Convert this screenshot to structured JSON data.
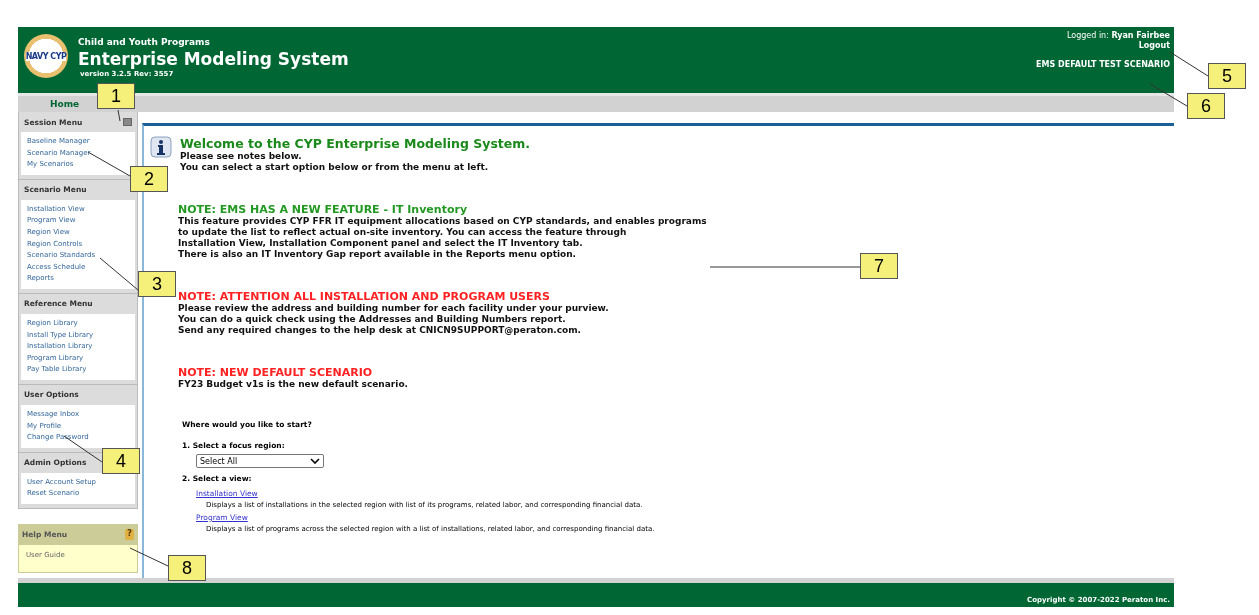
{
  "header": {
    "org": "Child and Youth Programs",
    "title": "Enterprise Modeling System",
    "version": "version 3.2.5 Rev: 3557",
    "logo_text": "NAVY CYP",
    "logged_in_label": "Logged in:",
    "user": "Ryan Fairbee",
    "logout": "Logout",
    "scenario": "EMS DEFAULT TEST SCENARIO"
  },
  "nav": {
    "home": "Home"
  },
  "sidebar": [
    {
      "title": "Session Menu",
      "kind": "normal",
      "collapse_icon": true,
      "items": [
        "Baseline Manager",
        "Scenario Manager",
        "My Scenarios"
      ]
    },
    {
      "title": "Scenario Menu",
      "kind": "normal",
      "items": [
        "Installation View",
        "Program View",
        "Region View",
        "Region Controls",
        "Scenario Standards",
        "Access Schedule",
        "Reports"
      ]
    },
    {
      "title": "Reference Menu",
      "kind": "normal",
      "items": [
        "Region Library",
        "Install Type Library",
        "Installation Library",
        "Program Library",
        "Pay Table Library"
      ]
    },
    {
      "title": "User Options",
      "kind": "normal",
      "items": [
        "Message Inbox",
        "My Profile",
        "Change Password"
      ]
    },
    {
      "title": "Admin Options",
      "kind": "normal",
      "items": [
        "User Account Setup",
        "Reset Scenario"
      ]
    },
    {
      "title": "Help Menu",
      "kind": "help",
      "help_icon": "?",
      "items": [
        "User Guide"
      ]
    }
  ],
  "welcome": {
    "title": "Welcome to the CYP Enterprise Modeling System.",
    "lines": [
      "Please see notes below.",
      "You can select a start option below or from the menu at left."
    ]
  },
  "notes": [
    {
      "title": "NOTE: EMS HAS A NEW FEATURE - IT Inventory",
      "color": "#229922",
      "lines": [
        "This feature provides CYP FFR IT equipment allocations based on CYP standards, and enables programs",
        "to update the list to reflect actual on-site inventory. You can access the feature through",
        "Installation View, Installation Component panel and select the IT Inventory tab.",
        "There is also an IT Inventory Gap report available in the Reports menu option."
      ]
    },
    {
      "title": "NOTE: ATTENTION ALL INSTALLATION AND PROGRAM USERS",
      "color": "#ff2222",
      "lines": [
        "Please review the address and building number for each facility under your purview.",
        "You can do a quick check using the Addresses and Building Numbers report.",
        "Send any required changes to the help desk at CNICN9SUPPORT@peraton.com."
      ]
    },
    {
      "title": "NOTE: NEW DEFAULT SCENARIO",
      "color": "#ff2222",
      "lines": [
        "FY23 Budget v1s is the new default scenario."
      ]
    }
  ],
  "start": {
    "question": "Where would you like to start?",
    "step1": "1. Select a focus region:",
    "region_select": "Select All",
    "step2": "2. Select a view:",
    "views": [
      {
        "link": "Installation View",
        "description": "Displays a list of installations in the selected region with list of its programs, related labor, and corresponding financial data."
      },
      {
        "link": "Program View",
        "description": "Displays a list of programs across the selected region with a list of installations, related labor, and corresponding financial data."
      }
    ]
  },
  "footer": {
    "copyright": "Copyright © 2007-2022 Peraton Inc."
  },
  "callouts": [
    "1",
    "2",
    "3",
    "4",
    "5",
    "6",
    "7",
    "8"
  ]
}
